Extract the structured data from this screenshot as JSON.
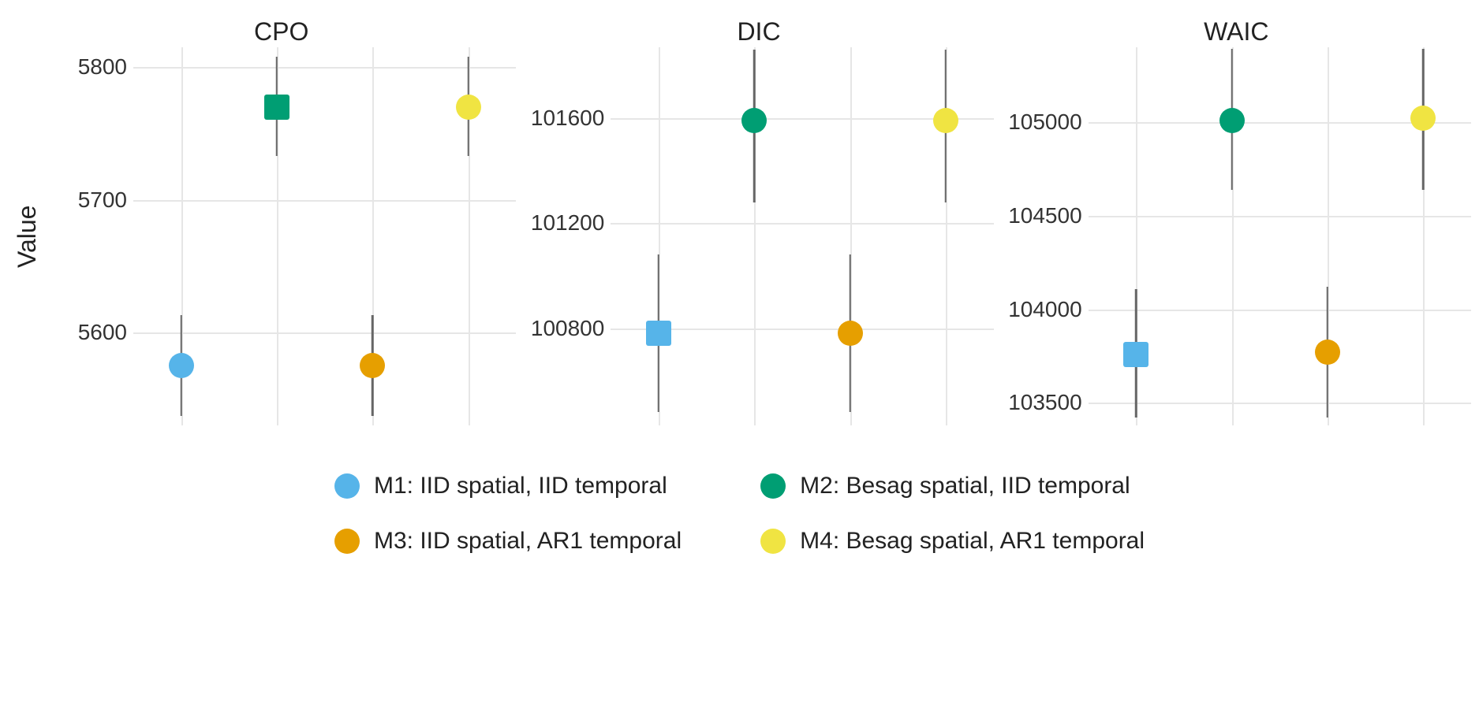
{
  "ylabel": "Value",
  "colors": {
    "M1": "#56b4e9",
    "M2": "#009e73",
    "M3": "#e69f00",
    "M4": "#f0e442"
  },
  "legend": [
    {
      "key": "M1",
      "label": "M1: IID spatial, IID temporal"
    },
    {
      "key": "M2",
      "label": "M2: Besag spatial, IID temporal"
    },
    {
      "key": "M3",
      "label": "M3: IID spatial, AR1 temporal"
    },
    {
      "key": "M4",
      "label": "M4: Besag spatial, AR1 temporal"
    }
  ],
  "chart_data": [
    {
      "title": "CPO",
      "ylim": [
        5530,
        5815
      ],
      "yticks": [
        5600,
        5700,
        5800
      ],
      "xpos": [
        12.5,
        37.5,
        62.5,
        87.5
      ],
      "best": "M2",
      "series": [
        {
          "key": "M1",
          "value": 5575,
          "low": 5537,
          "high": 5613
        },
        {
          "key": "M2",
          "value": 5770,
          "low": 5733,
          "high": 5808
        },
        {
          "key": "M3",
          "value": 5575,
          "low": 5537,
          "high": 5613
        },
        {
          "key": "M4",
          "value": 5770,
          "low": 5733,
          "high": 5808
        }
      ]
    },
    {
      "title": "DIC",
      "ylim": [
        100430,
        101870
      ],
      "yticks": [
        100800,
        101200,
        101600
      ],
      "xpos": [
        12.5,
        37.5,
        62.5,
        87.5
      ],
      "best": "M1",
      "series": [
        {
          "key": "M1",
          "value": 100780,
          "low": 100480,
          "high": 101080
        },
        {
          "key": "M2",
          "value": 101590,
          "low": 101280,
          "high": 101860
        },
        {
          "key": "M3",
          "value": 100780,
          "low": 100480,
          "high": 101080
        },
        {
          "key": "M4",
          "value": 101590,
          "low": 101280,
          "high": 101860
        }
      ]
    },
    {
      "title": "WAIC",
      "ylim": [
        103380,
        105400
      ],
      "yticks": [
        103500,
        104000,
        104500,
        105000
      ],
      "xpos": [
        12.5,
        37.5,
        62.5,
        87.5
      ],
      "best": "M1",
      "series": [
        {
          "key": "M1",
          "value": 103760,
          "low": 103420,
          "high": 104110
        },
        {
          "key": "M2",
          "value": 105010,
          "low": 104640,
          "high": 105390
        },
        {
          "key": "M3",
          "value": 103770,
          "low": 103420,
          "high": 104120
        },
        {
          "key": "M4",
          "value": 105020,
          "low": 104640,
          "high": 105390
        }
      ]
    }
  ]
}
